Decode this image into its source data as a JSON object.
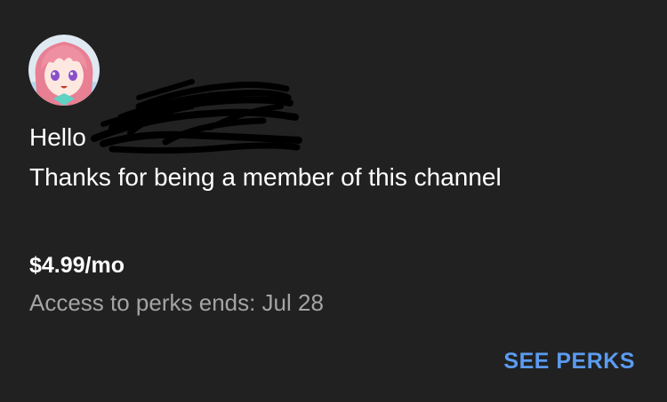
{
  "greeting": "Hello",
  "message": "Thanks for being a member of this channel",
  "membership": {
    "price": "$4.99/mo",
    "perks_end": "Access to perks ends: Jul 28"
  },
  "actions": {
    "see_perks": "SEE PERKS"
  },
  "colors": {
    "background": "#212121",
    "text": "#ffffff",
    "secondary_text": "#a4a4a4",
    "accent": "#5b9bf0"
  },
  "icons": {
    "avatar": "channel-avatar-anime-girl-pink-hair"
  }
}
